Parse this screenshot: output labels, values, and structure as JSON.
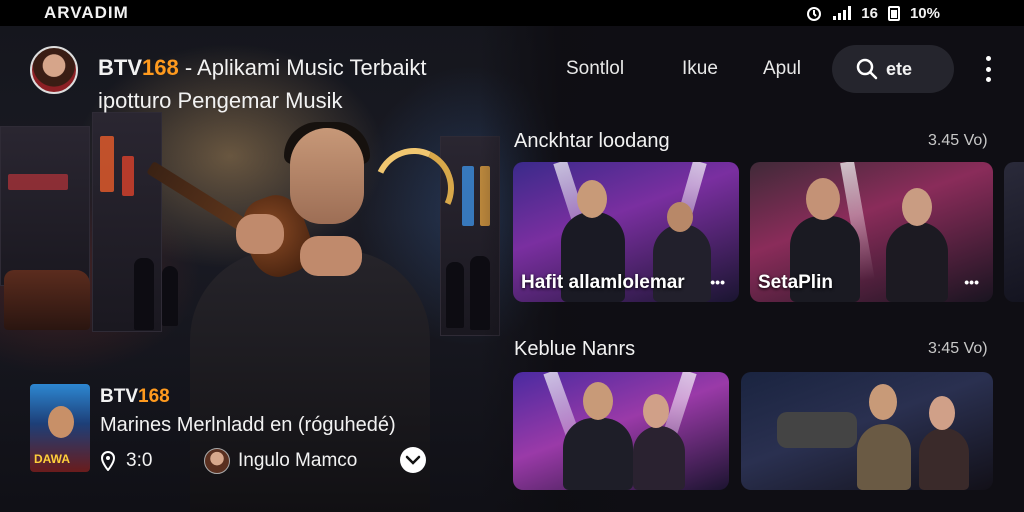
{
  "status_bar": {
    "time": "ARVADIM",
    "indicators": "16",
    "battery": "10%"
  },
  "header": {
    "brand_prefix": "BTV",
    "brand_number": "168",
    "title_rest": " - Aplikami Music Terbaikt",
    "subtitle": "ipotturo Pengemar Musik",
    "nav": [
      "Sontlol",
      "Ikue",
      "Apul"
    ],
    "search_label": "ete"
  },
  "sections": [
    {
      "title": "Anckhtar loodang",
      "more": "3.45 Vo)",
      "cards": [
        {
          "label": "Hafit allamlolemar",
          "dots": "•••"
        },
        {
          "label": "SetaPlin",
          "dots": "•••"
        }
      ]
    },
    {
      "title": "Keblue Nanrs",
      "more": "3:45 Vo)"
    }
  ],
  "now_playing": {
    "brand_prefix": "BTV",
    "brand_number": "168",
    "track": "Marines Merlnladd en (róguhedé)",
    "count": "3:0",
    "artist": "Ingulo Mamco",
    "art_text": "DAWA"
  },
  "colors": {
    "accent": "#ff9a1e",
    "background": "#0f0e14"
  }
}
